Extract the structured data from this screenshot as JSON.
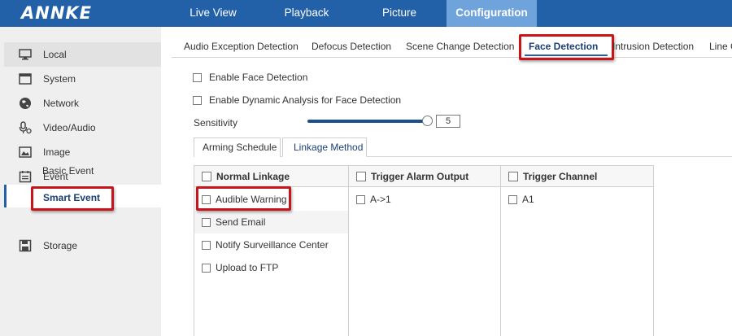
{
  "app": {
    "logo": "ANNKE"
  },
  "nav": {
    "live_view": "Live View",
    "playback": "Playback",
    "picture": "Picture",
    "configuration": "Configuration"
  },
  "sidebar": {
    "items": [
      {
        "label": "Local",
        "icon": "monitor-icon"
      },
      {
        "label": "System",
        "icon": "window-icon"
      },
      {
        "label": "Network",
        "icon": "globe-icon"
      },
      {
        "label": "Video/Audio",
        "icon": "microphone-icon"
      },
      {
        "label": "Image",
        "icon": "image-icon"
      },
      {
        "label": "Event",
        "icon": "calendar-icon"
      },
      {
        "label": "Storage",
        "icon": "floppy-icon"
      }
    ],
    "sub_items": {
      "basic_event": "Basic Event",
      "smart_event": "Smart Event"
    }
  },
  "subtabs": {
    "audio_exception": "Audio Exception Detection",
    "defocus": "Defocus Detection",
    "scene_change": "Scene Change Detection",
    "face": "Face Detection",
    "intrusion": "Intrusion Detection",
    "line": "Line C"
  },
  "form": {
    "enable_face": "Enable Face Detection",
    "enable_dynamic": "Enable Dynamic Analysis for Face Detection",
    "sensitivity_label": "Sensitivity",
    "sensitivity_value": "5"
  },
  "inner_tabs": {
    "arming": "Arming Schedule",
    "linkage": "Linkage Method"
  },
  "linkage_table": {
    "normal_header": "Normal Linkage",
    "alarm_header": "Trigger Alarm Output",
    "channel_header": "Trigger Channel",
    "normal_items": [
      "Audible Warning",
      "Send Email",
      "Notify Surveillance Center",
      "Upload to FTP"
    ],
    "alarm_items": [
      "A->1"
    ],
    "channel_items": [
      "A1"
    ]
  },
  "colors": {
    "brand_blue": "#2260a8",
    "active_tab": "#6fa3db",
    "highlight_red": "#c8151b"
  }
}
